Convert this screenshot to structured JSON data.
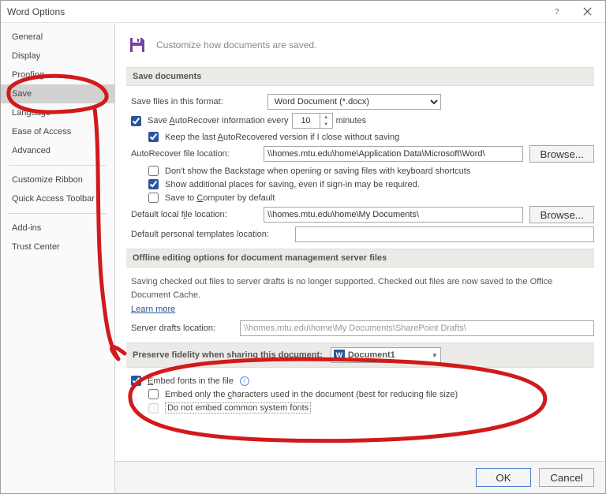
{
  "titlebar": {
    "title": "Word Options"
  },
  "sidebar": {
    "items": [
      "General",
      "Display",
      "Proofing",
      "Save",
      "Language",
      "Ease of Access",
      "Advanced"
    ],
    "items2": [
      "Customize Ribbon",
      "Quick Access Toolbar"
    ],
    "items3": [
      "Add-ins",
      "Trust Center"
    ],
    "selected": "Save"
  },
  "header": {
    "text": "Customize how documents are saved."
  },
  "sec_save": {
    "title": "Save documents",
    "format_label": "Save files in this format:",
    "format_value": "Word Document (*.docx)",
    "autorecover_label_pre": "Save ",
    "autorecover_label_u": "A",
    "autorecover_label_post": "utoRecover information every",
    "autorecover_value": "10",
    "minutes": "minutes",
    "keeplast_pre": "Keep the last ",
    "keeplast_u": "A",
    "keeplast_post": "utoRecovered version if I close without saving",
    "ar_loc_label": "AutoRecover file location:",
    "ar_loc_value": "\\\\homes.mtu.edu\\home\\Application Data\\Microsoft\\Word\\",
    "browse": "Browse...",
    "dontshow": "Don't show the Backstage when opening or saving files with keyboard shortcuts",
    "showadd": "Show additional places for saving, even if sign-in may be required.",
    "savetoc_u": "C",
    "savetoc_post": "omputer by default",
    "defloc_label": "Default local file location:",
    "defloc_value": "\\\\homes.mtu.edu\\home\\My Documents\\",
    "tmpl_label": "Default personal templates location:",
    "tmpl_value": ""
  },
  "sec_offline": {
    "title": "Offline editing options for document management server files",
    "desc": "Saving checked out files to server drafts is no longer supported. Checked out files are now saved to the Office Document Cache.",
    "learn": "Learn more",
    "drafts_label": "Server drafts location:",
    "drafts_value": "\\\\homes.mtu.edu\\home\\My Documents\\SharePoint Drafts\\"
  },
  "sec_preserve": {
    "title": "Preserve fidelity when sharing this document:",
    "doc": "Document1",
    "embed_u": "E",
    "embed_post": "mbed fonts in the file",
    "only_pre": "Embed only the ",
    "only_u": "c",
    "only_post": "haracters used in the document (best for reducing file size)",
    "common": "Do not embed common system fonts"
  },
  "footer": {
    "ok": "OK",
    "cancel": "Cancel"
  },
  "checks": {
    "autorecover": true,
    "keeplast": true,
    "dontshow": false,
    "showadd": true,
    "savetoc": false,
    "embed": true,
    "only": false,
    "common": false
  }
}
